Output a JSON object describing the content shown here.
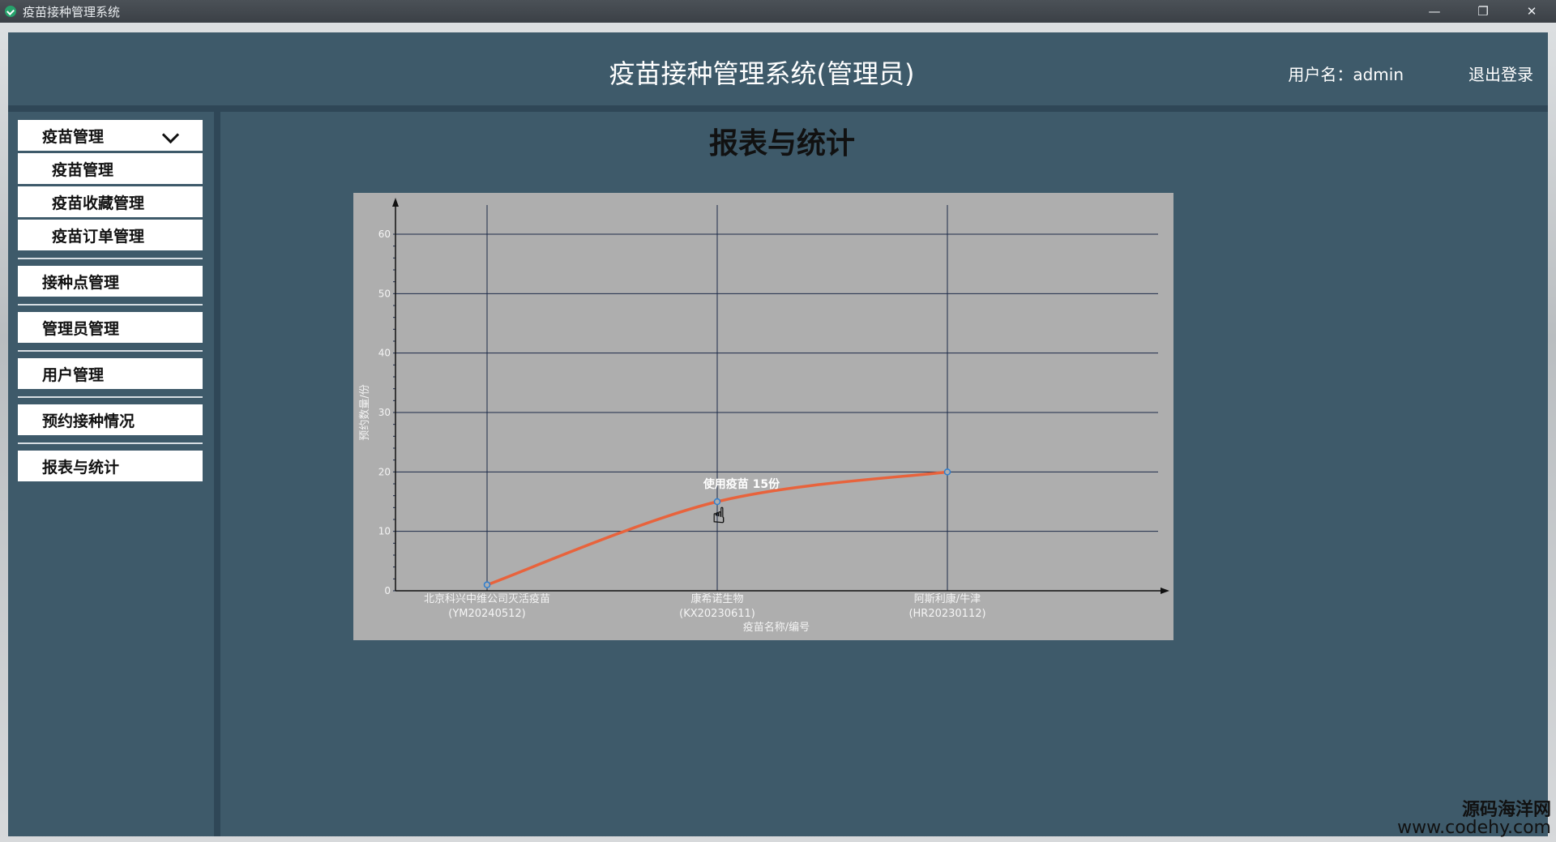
{
  "window": {
    "title": "疫苗接种管理系统",
    "minimize": "—",
    "restore": "❐",
    "close": "✕"
  },
  "header": {
    "title": "疫苗接种管理系统(管理员)",
    "user": "用户名：admin",
    "logout": "退出登录"
  },
  "sidebar": {
    "group": "疫苗管理",
    "sub_items": [
      "疫苗管理",
      "疫苗收藏管理",
      "疫苗订单管理"
    ],
    "items": [
      "接种点管理",
      "管理员管理",
      "用户管理",
      "预约接种情况",
      "报表与统计"
    ]
  },
  "main": {
    "page_title": "报表与统计"
  },
  "colors": {
    "line": "#e8633c",
    "grid": "#1c2a48",
    "point": "#2f7fd0"
  },
  "chart_data": {
    "type": "line",
    "categories": [
      "北京科兴中维公司灭活疫苗\n(YM20240512)",
      "康希诺生物\n(KX20230611)",
      "阿斯利康/牛津\n(HR20230112)"
    ],
    "values": [
      1,
      15,
      20
    ],
    "xlabel": "疫苗名称/编号",
    "ylabel": "预约数量/份",
    "ylim": [
      0,
      60
    ],
    "yticks": [
      0,
      10,
      20,
      30,
      40,
      50,
      60
    ],
    "grid": true,
    "tooltip": "使用疫苗 15份"
  },
  "watermark": {
    "line1": "源码海洋网",
    "line2": "www.codehy.com"
  }
}
